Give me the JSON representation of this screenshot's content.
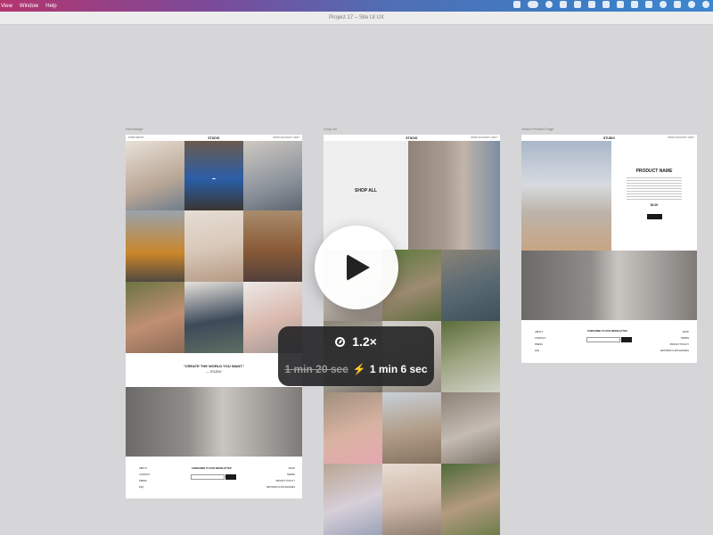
{
  "menubar": {
    "items": [
      "View",
      "Window",
      "Help"
    ]
  },
  "window": {
    "title": "Project 17 – Site UI UX"
  },
  "frames": {
    "homepage": {
      "label": "Homepage",
      "nav": {
        "logo": "STUDIO",
        "left": "SHOP   ABOUT",
        "right": "SHOP   ACCOUNT   CART"
      },
      "quote_text": "\"CREATE THE WORLD YOU WANT.\"",
      "quote_author": "— STUDIO",
      "footer_left": [
        "ABOUT",
        "CONTACT",
        "PRESS",
        "FAQ"
      ],
      "newsletter_title": "SUBSCRIBE TO OUR NEWSLETTER",
      "footer_right": [
        "SHOP",
        "TERMS",
        "PRIVACY POLICY",
        "RETURNS & EXCHANGES"
      ]
    },
    "shop_all": {
      "label": "Shop All",
      "nav": {
        "logo": "STUDIO",
        "right": "SHOP   ACCOUNT   CART"
      },
      "hero_text": "SHOP ALL"
    },
    "product": {
      "label": "Select Product Page",
      "nav": {
        "logo": "STUDIO",
        "right": "SHOP   ACCOUNT   CART"
      },
      "title": "PRODUCT NAME",
      "price": "$0.00",
      "footer_left": [
        "ABOUT",
        "CONTACT",
        "PRESS",
        "FAQ"
      ],
      "newsletter_title": "SUBSCRIBE TO OUR NEWSLETTER",
      "footer_right": [
        "SHOP",
        "TERMS",
        "PRIVACY POLICY",
        "RETURNS & EXCHANGES"
      ]
    }
  },
  "overlay": {
    "speed": "1.2×",
    "original_time": "1 min 20 sec",
    "new_time": "1 min 6 sec",
    "icons": [
      "play-icon",
      "gauge-icon",
      "bolt-icon"
    ]
  }
}
